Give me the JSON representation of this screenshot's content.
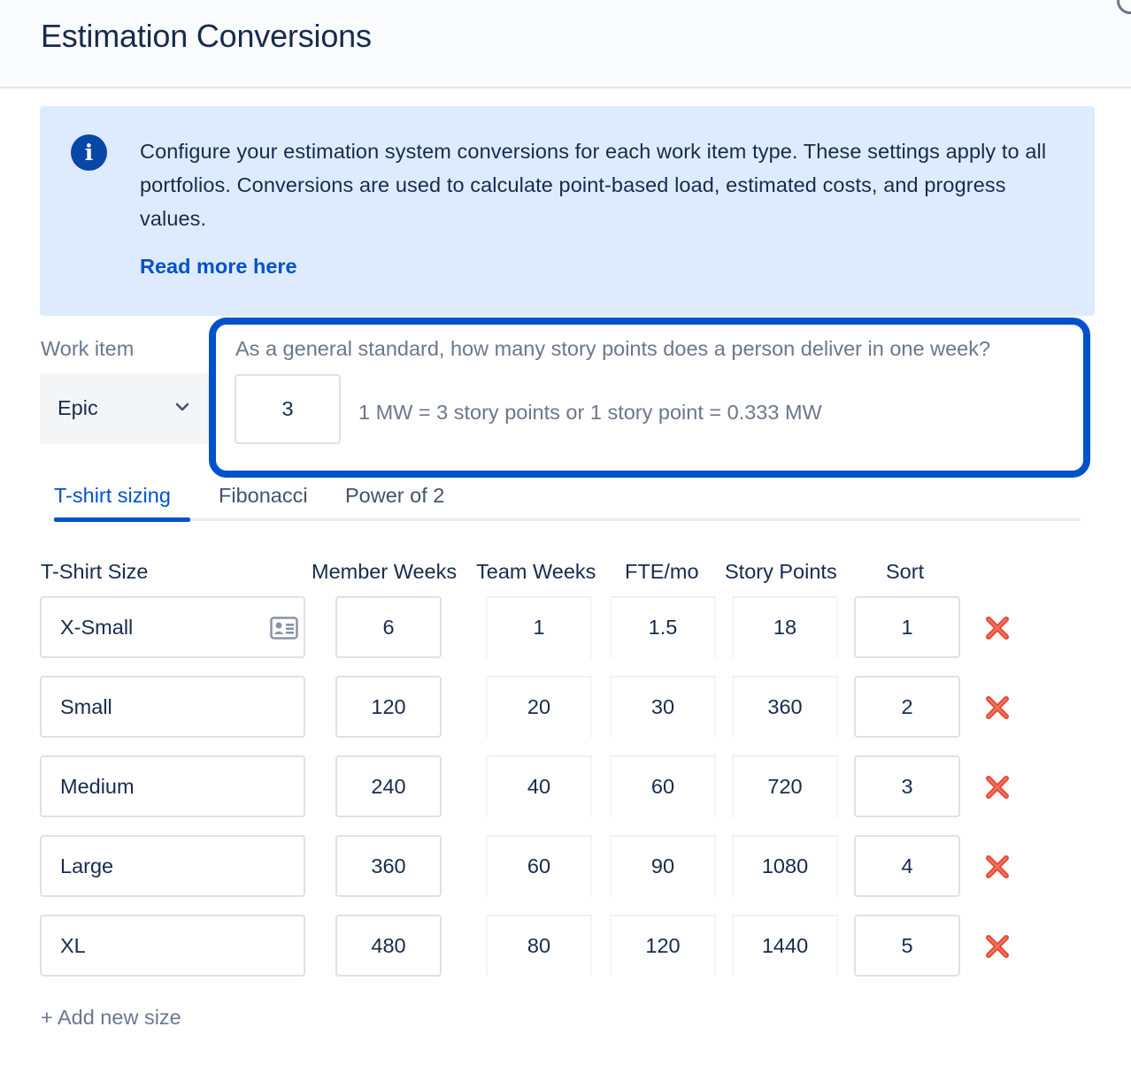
{
  "header": {
    "title": "Estimation Conversions"
  },
  "info": {
    "text": "Configure your estimation system conversions for each work item type. These settings apply to all portfolios. Conversions are used to calculate point-based load, estimated costs, and progress values.",
    "link": "Read more here"
  },
  "work_item": {
    "label": "Work item",
    "selected": "Epic"
  },
  "points_per_week": {
    "question": "As a general standard, how many story points does a person deliver in one week?",
    "value": "3",
    "conversion_text": "1 MW = 3 story points or 1 story point = 0.333 MW"
  },
  "tabs": [
    {
      "label": "T-shirt sizing",
      "active": true
    },
    {
      "label": "Fibonacci",
      "active": false
    },
    {
      "label": "Power of 2",
      "active": false
    }
  ],
  "table": {
    "headers": [
      "T-Shirt Size",
      "Member Weeks",
      "Team Weeks",
      "FTE/mo",
      "Story Points",
      "Sort"
    ],
    "rows": [
      {
        "size": "X-Small",
        "member_weeks": "6",
        "team_weeks": "1",
        "fte_mo": "1.5",
        "story_points": "18",
        "sort": "1"
      },
      {
        "size": "Small",
        "member_weeks": "120",
        "team_weeks": "20",
        "fte_mo": "30",
        "story_points": "360",
        "sort": "2"
      },
      {
        "size": "Medium",
        "member_weeks": "240",
        "team_weeks": "40",
        "fte_mo": "60",
        "story_points": "720",
        "sort": "3"
      },
      {
        "size": "Large",
        "member_weeks": "360",
        "team_weeks": "60",
        "fte_mo": "90",
        "story_points": "1080",
        "sort": "4"
      },
      {
        "size": "XL",
        "member_weeks": "480",
        "team_weeks": "80",
        "fte_mo": "120",
        "story_points": "1440",
        "sort": "5"
      }
    ]
  },
  "add_link": "+ Add new size",
  "colors": {
    "primary": "#0052cc",
    "info_bg": "#deebff",
    "info_icon": "#0747a6",
    "delete": "#e34935"
  }
}
